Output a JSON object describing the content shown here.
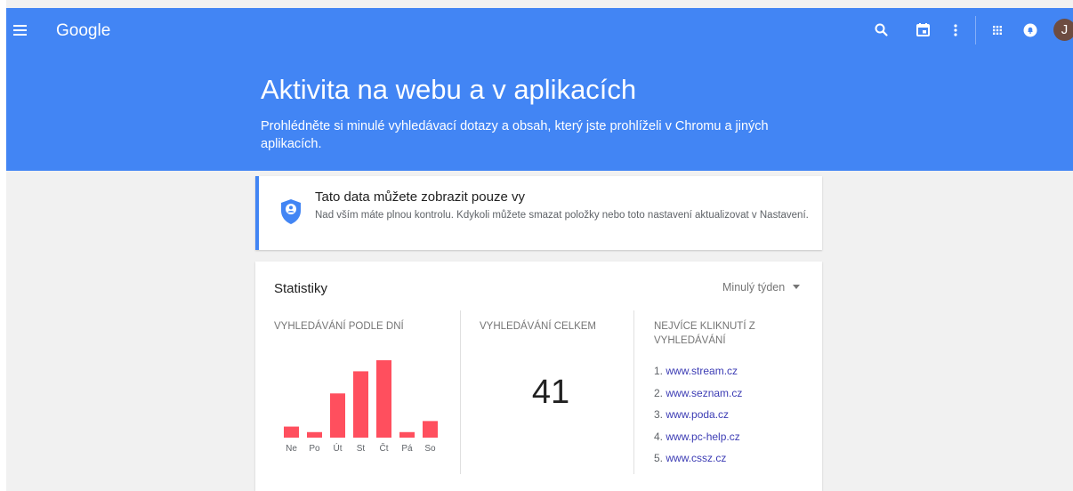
{
  "topbar": {
    "logo": "Google",
    "icons": [
      "menu-icon",
      "search-icon",
      "calendar-icon",
      "more-vert-icon",
      "apps-icon",
      "notifications-icon"
    ],
    "avatar_letter": "J",
    "avatar_color": "#6d4c41",
    "brand_color": "#4285f4"
  },
  "hero": {
    "title": "Aktivita na webu a v aplikacích",
    "description": "Prohlédněte si minulé vyhledávací dotazy a obsah, který jste prohlíželi v Chromu a jiných aplikacích."
  },
  "privacy": {
    "title": "Tato data můžete zobrazit pouze vy",
    "text": "Nad vším máte plnou kontrolu. Kdykoli můžete smazat položky nebo toto nastavení aktualizovat v Nastavení."
  },
  "stats": {
    "title": "Statistiky",
    "period": "Minulý týden",
    "by_day_label": "VYHLEDÁVÁNÍ PODLE DNÍ",
    "total_label": "VYHLEDÁVÁNÍ CELKEM",
    "total_value": "41",
    "top_clicks_label": "NEJVÍCE KLIKNUTÍ Z VYHLEDÁVÁNÍ",
    "top_sites": [
      {
        "rank": "1.",
        "site": "www.stream.cz"
      },
      {
        "rank": "2.",
        "site": "www.seznam.cz"
      },
      {
        "rank": "3.",
        "site": "www.poda.cz"
      },
      {
        "rank": "4.",
        "site": "www.pc-help.cz"
      },
      {
        "rank": "5.",
        "site": "www.cssz.cz"
      }
    ]
  },
  "chart_data": {
    "type": "bar",
    "categories": [
      "Ne",
      "Po",
      "Út",
      "St",
      "Čt",
      "Pá",
      "So"
    ],
    "values": [
      2,
      1,
      8,
      12,
      14,
      1,
      3
    ],
    "ylim": [
      0,
      14
    ],
    "bar_color": "#ff4f5e",
    "grid": false
  }
}
